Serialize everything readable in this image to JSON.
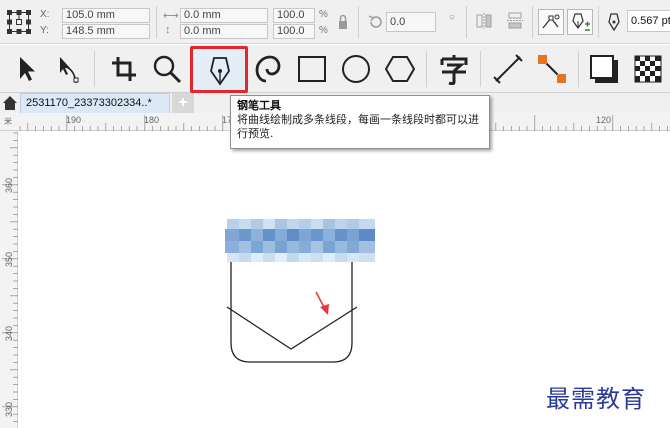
{
  "propbar": {
    "x_label": "X:",
    "y_label": "Y:",
    "x_value": "105.0 mm",
    "y_value": "148.5 mm",
    "width_value": "0.0 mm",
    "height_value": "0.0 mm",
    "scale_x": "100.0",
    "scale_y": "100.0",
    "percent": "%",
    "rotation": "0.0",
    "outline_width": "0.567 pt"
  },
  "tabs": {
    "document": "2531170_23373302334..*",
    "add": "+"
  },
  "tooltip": {
    "title": "钢笔工具",
    "description": "将曲线绘制成多条线段，每画一条线段时都可以进行预览."
  },
  "ruler": {
    "h_labels": [
      "190",
      "180",
      "17",
      "120"
    ],
    "v_labels": [
      "360",
      "350",
      "340",
      "330"
    ],
    "corner": "米"
  },
  "watermark": "最需教育",
  "colors": {
    "highlight": "#e2262a",
    "tab": "#dce8f5",
    "arrow": "#e23b3b"
  },
  "tools": [
    "pick-tool",
    "shape-tool",
    "crop-tool",
    "zoom-tool",
    "pen-tool",
    "spiral-tool",
    "rectangle-tool",
    "ellipse-tool",
    "polygon-tool",
    "text-tool",
    "dimension-tool",
    "connector-tool",
    "drop-shadow-tool",
    "transparency-tool"
  ]
}
